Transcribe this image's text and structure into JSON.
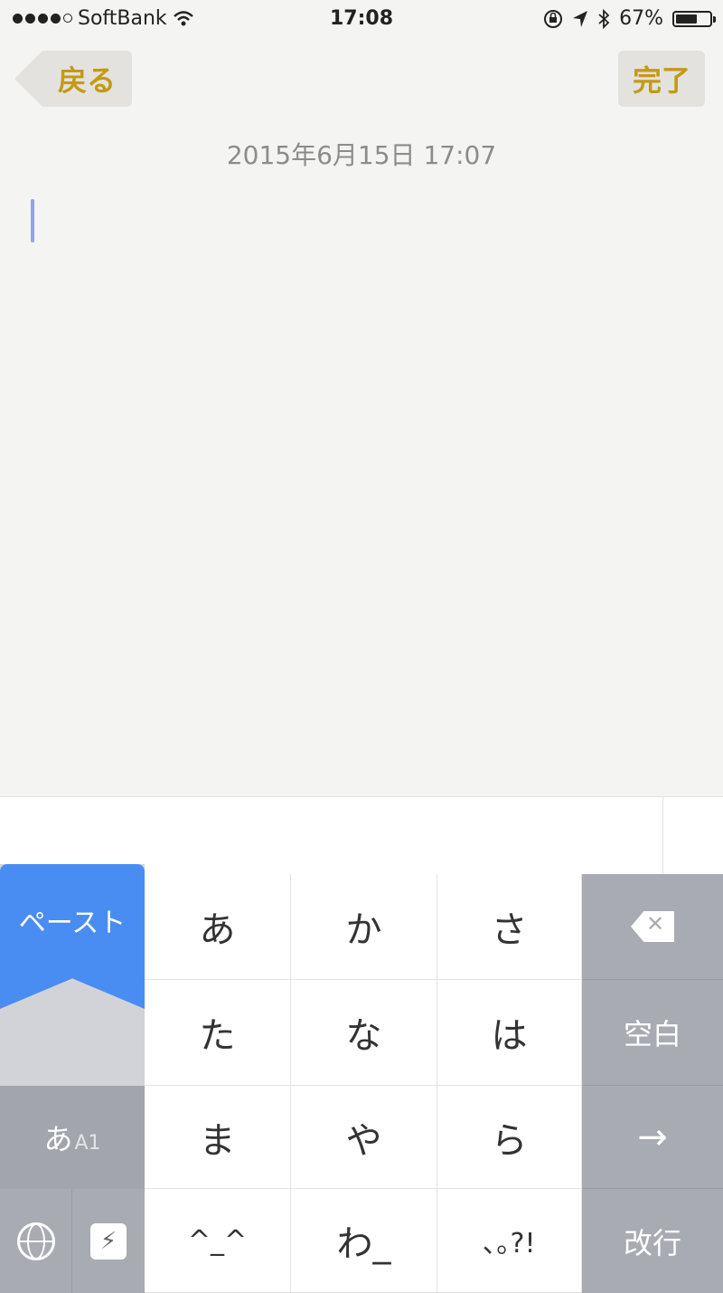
{
  "status_bar": {
    "carrier": "SoftBank",
    "time": "17:08",
    "battery_percent": "67%",
    "battery_level": 0.67
  },
  "nav": {
    "back_label": "戻る",
    "done_label": "完了"
  },
  "note": {
    "date": "2015年6月15日 17:07"
  },
  "keyboard": {
    "paste_label": "ペースト",
    "mode_label": "あ",
    "mode_sub": "A1",
    "bolt_glyph": "⚡",
    "keys": [
      "あ",
      "か",
      "さ",
      "た",
      "な",
      "は",
      "ま",
      "や",
      "ら",
      "^_^",
      "わ_",
      "､｡?!"
    ],
    "space_label": "空白",
    "arrow_label": "→",
    "return_label": "改行"
  },
  "colors": {
    "accent": "#c49a16",
    "paste_blue": "#4a8df2",
    "function_key": "#a9abb2"
  }
}
